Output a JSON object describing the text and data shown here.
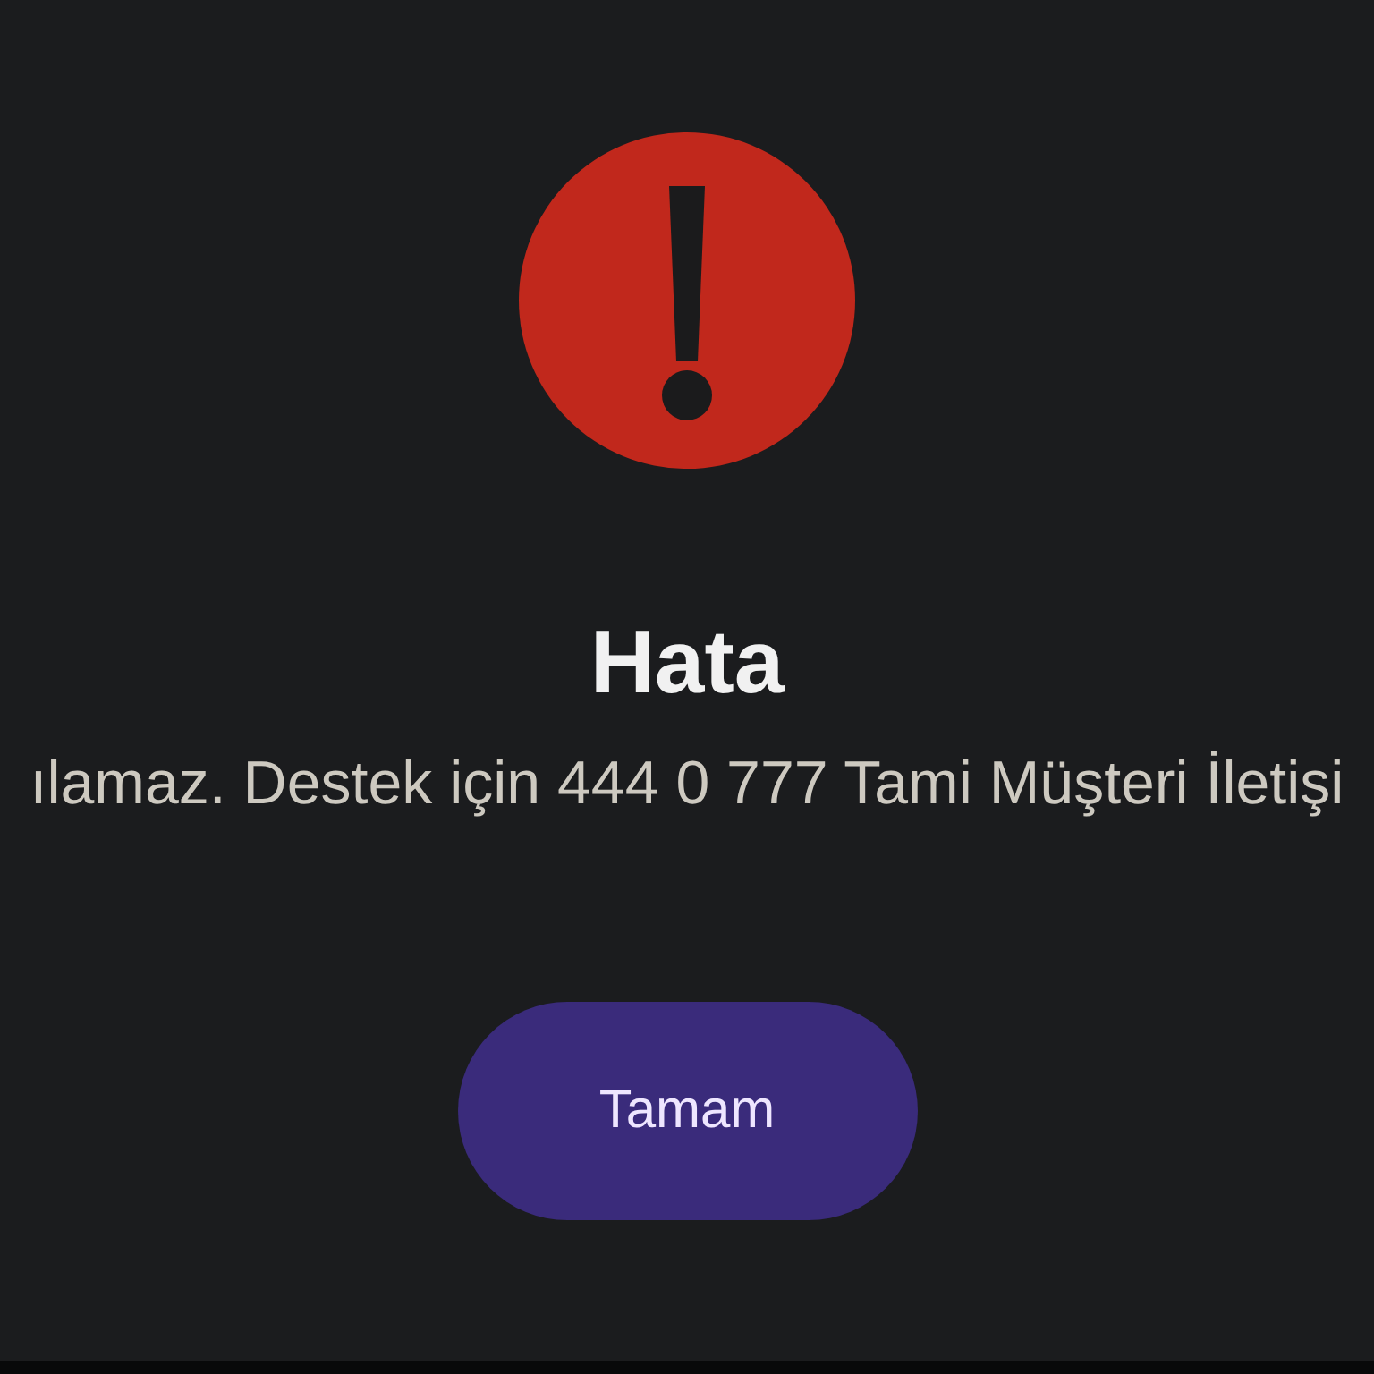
{
  "dialog": {
    "title": "Hata",
    "message": "ılamaz. Destek için 444 0 777 Tami Müşteri İletişi",
    "buttons": [
      {
        "label": "Tamam"
      }
    ]
  }
}
